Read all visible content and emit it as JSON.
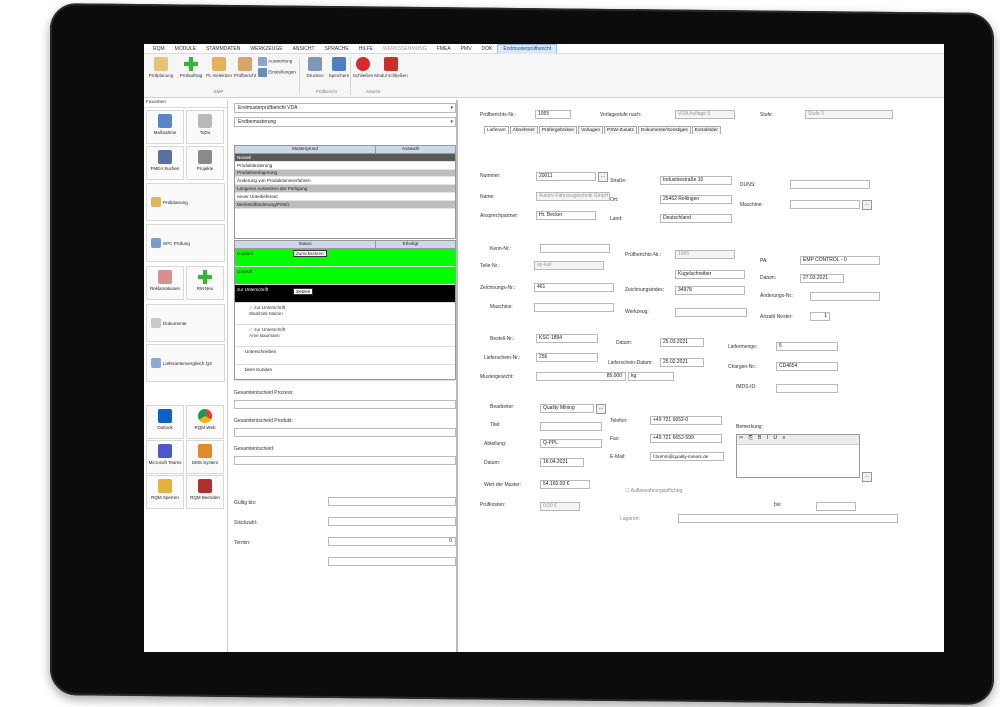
{
  "menu": {
    "items": [
      "RQM",
      "MODULE",
      "STAMMDATEN",
      "WERKZEUGE",
      "ANSICHT",
      "SPRACHE",
      "HILFE",
      "WERKSSENMUNG",
      "FMEA",
      "PMV",
      "DOK"
    ],
    "active": "Erstmusterprüfbericht"
  },
  "ribbon": {
    "buttons": [
      "Prüfplanung",
      "Prüfauftrag",
      "PL-Selektion",
      "Prüfbericht",
      "Auswertung",
      "Einstellungen",
      "Drucken",
      "Speichern",
      "Schließen",
      "Modul schließen"
    ],
    "groups": [
      "EMP",
      "Prüfbericht",
      "Ansicht"
    ]
  },
  "favorites": {
    "title": "Favoriten",
    "tiles": [
      "Maßnahme",
      "ToDo",
      "FMEA Suchen",
      "Projekte",
      "Reklamationen",
      "RM Neu",
      "Outlook",
      "RQM.Web",
      "Microsoft Teams",
      "DMS System",
      "RQM Sperren",
      "RQM Beenden"
    ],
    "wide": [
      "Prüfplanung",
      "SPC Prüfung",
      "Dokumente",
      "Lieferantenvergleich QZ"
    ]
  },
  "middle": {
    "report_type": "Erstmusterprüfbericht VDA",
    "reason_select": "Erstbemusterung",
    "grid1": {
      "col1": "Mustergrund",
      "col2": "Auswahl",
      "rows": [
        "Neuteil",
        "Produktänderung",
        "Produktverlagerung",
        "Änderung von Produktionsverfahren",
        "Längeres Aussetzen der Fertigung",
        "neuer Unterlieferant",
        "Werkstoffänderung/PSW)"
      ]
    },
    "grid2": {
      "col1": "Status",
      "col2": "Erledigt",
      "rows": [
        "Geplant",
        "Geprüft",
        "zur Unterschrift",
        "zur Unterschrift",
        "Wanitzek Marvin",
        "zur Unterschrift",
        "Arne Baumann",
        "Unterschreiben",
        "beim Kunden"
      ],
      "btn_reset": "Zurücksetzen",
      "btn_set": "Setzen"
    },
    "labels": {
      "gesamt_prozess": "Gesamtentscheid Prozess:",
      "gesamt_produkt": "Gesamtentscheid Produkt:",
      "gesamt": "Gesamtentscheid:",
      "gueltig": "Gültig bis:",
      "stueckzahl": "Stückzahl:",
      "termin": "Termin:"
    },
    "stueckzahl_value": "0"
  },
  "right": {
    "pb_nr_label": "Prüfberichts-Nr.:",
    "pb_nr": "1055",
    "vorlage_label": "Vorlagestufe nach:",
    "vorlage": "VDA Auflage 5",
    "stufe_label": "Stufe:",
    "stufe": "Stufe 3",
    "tabs": [
      "Lieferant",
      "Abnehmer",
      "Prüfergebnisse",
      "Vorlagen",
      "PSW-Zusatz",
      "Dokumente/Sonstiges",
      "Extrafelder"
    ],
    "nummer_label": "Nummer:",
    "nummer": "20011",
    "name_label": "Name:",
    "name": "Autoliv Fahrzeugtechnik GmbH",
    "ansprech_label": "Ansprechpartner:",
    "ansprech": "Hr. Becker",
    "strasse_label": "Straße:",
    "strasse": "Industriestraße 10",
    "ort_label": "Ort:",
    "ort": "25462 Rellingen",
    "land_label": "Land:",
    "land": "Deutschland",
    "duns_label": "DUNS:",
    "maschine_label": "Maschine:",
    "kenn_label": "Kenn-Nr.:",
    "teile_label": "Teile-Nr.:",
    "teile": "sp-kuli",
    "zeich_label": "Zeichnungs-Nr.:",
    "zeich": "461",
    "masch2_label": "Maschine:",
    "pb_nr2_label": "Prüfberichts-Nr.:",
    "pb_nr2": "1055",
    "zeichidx_label": "Zeichnungsindex:",
    "zeichidx": "34978",
    "werkzeug_label": "Werkzeug:",
    "kugel": "Kugelschreiber",
    "pa_label": "PA:",
    "pa": "EMP CONTROL - 0",
    "datum_label": "Datum:",
    "datum1": "27.03.2021",
    "aend_label": "Änderungs-Nr.:",
    "nester_label": "Anzahl Nester:",
    "nester": "1",
    "bestell_label": "Bestell-Nr.:",
    "bestell": "KSC-1894",
    "datum2_label": "Datum:",
    "datum2": "25.03.2021",
    "liefer_label": "Lieferschein-Nr.:",
    "liefer": "256",
    "lsdatum_label": "Lieferschein-Datum:",
    "lsdatum": "25.02.2021",
    "muster_label": "Mustergewicht:",
    "muster": "85,000",
    "einheit": "kg",
    "menge_label": "Liefermenge:",
    "menge": "5",
    "charge_label": "Chargen-Nr.:",
    "charge": "CD4654",
    "imds_label": "IMDS-ID:",
    "bearb_label": "Bearbeiter:",
    "bearb": "Quality Mining",
    "titel_label": "Titel:",
    "abt_label": "Abteilung:",
    "abt": "Q-PPL",
    "datum3_label": "Datum:",
    "datum3": "16.04.2021",
    "tel_label": "Telefon:",
    "tel": "+49 721 6652-0",
    "fax_label": "Fax:",
    "fax": "+49 721 6652-599",
    "email_label": "E-Mail:",
    "email": "f.brehm@quality-miners.de",
    "bem_label": "Bemerkung:",
    "wert_label": "Wert der Muster:",
    "wert": "54.160,00 €",
    "aufb_label": "Aufbewahrungspflichtig",
    "pruefk_label": "Prüfkosten:",
    "pruefk": "0,00 €",
    "bis_label": "bis:",
    "lager_label": "Lagerort:"
  }
}
